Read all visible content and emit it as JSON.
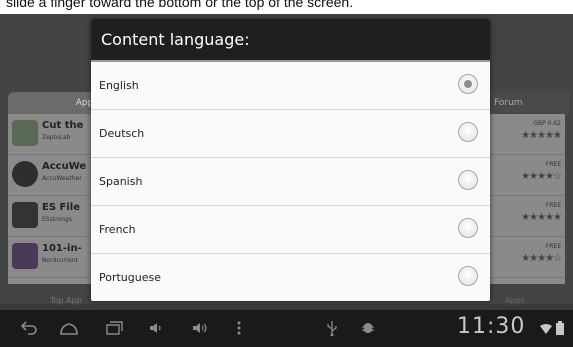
{
  "caption": "slide a finger toward the bottom or the top of the screen.",
  "background": {
    "tabs": {
      "apps": "Apps",
      "forum": "Forum"
    },
    "rows": [
      {
        "title": "Cut the",
        "subtitle": "ZeptoLab",
        "price": "GBP 0.62",
        "stars": "★★★★★"
      },
      {
        "title": "AccuWe",
        "subtitle": "AccuWeather",
        "price": "FREE",
        "stars": "★★★★☆"
      },
      {
        "title": "ES File",
        "subtitle": "ESstrongs",
        "price": "FREE",
        "stars": "★★★★★"
      },
      {
        "title": "101-in-",
        "subtitle": "Nordcurrent",
        "price": "FREE",
        "stars": "★★★★☆"
      }
    ],
    "bottom_left": "Top App",
    "bottom_right": "Apps"
  },
  "dialog": {
    "title": "Content language:",
    "options": [
      {
        "label": "English",
        "selected": true
      },
      {
        "label": "Deutsch",
        "selected": false
      },
      {
        "label": "Spanish",
        "selected": false
      },
      {
        "label": "French",
        "selected": false
      },
      {
        "label": "Portuguese",
        "selected": false
      }
    ]
  },
  "navbar": {
    "icons": [
      "back-icon",
      "home-icon",
      "recent-apps-icon",
      "volume-down-icon",
      "volume-up-icon",
      "menu-icon",
      "usb-icon",
      "debug-icon",
      "wifi-icon",
      "battery-icon"
    ],
    "clock": "11:30"
  }
}
